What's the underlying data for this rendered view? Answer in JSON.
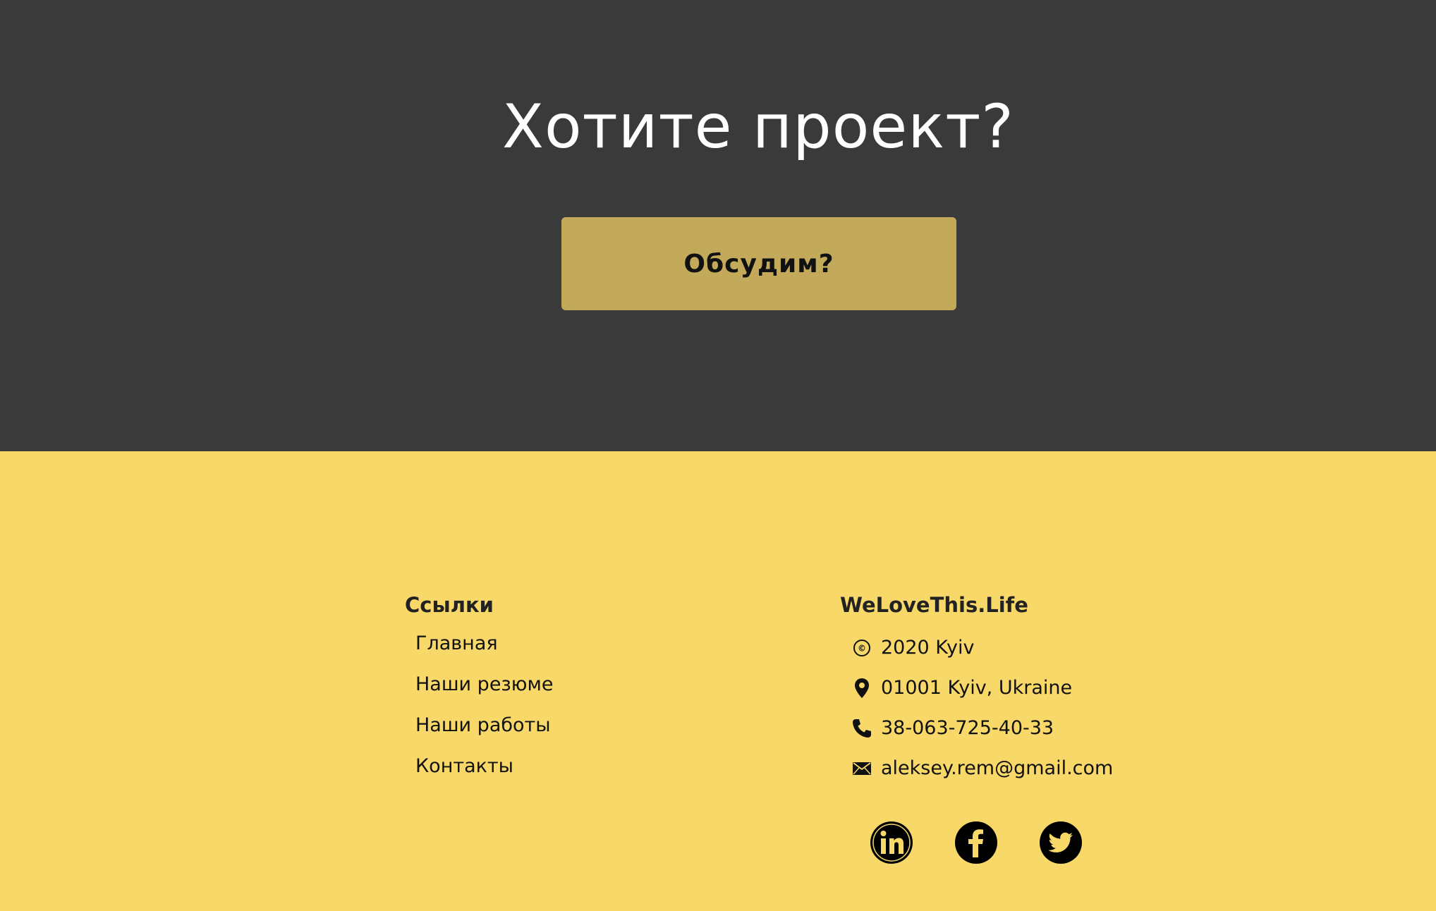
{
  "hero": {
    "title": "Хотите проект?",
    "cta_label": "Обсудим?"
  },
  "footer": {
    "links_title": "Ссылки",
    "links": [
      {
        "label": "Главная"
      },
      {
        "label": "Наши резюме"
      },
      {
        "label": "Наши работы"
      },
      {
        "label": "Контакты"
      }
    ],
    "brand_title": "WeLoveThis.Life",
    "contacts": [
      {
        "icon": "copyright-icon",
        "text": "2020 Kyiv"
      },
      {
        "icon": "location-pin-icon",
        "text": "01001 Kyiv, Ukraine"
      },
      {
        "icon": "phone-icon",
        "text": "38-063-725-40-33"
      },
      {
        "icon": "envelope-icon",
        "text": "aleksey.rem@gmail.com"
      }
    ],
    "social": [
      {
        "icon": "linkedin-icon"
      },
      {
        "icon": "facebook-icon"
      },
      {
        "icon": "twitter-icon"
      }
    ]
  },
  "colors": {
    "hero_bg": "#3a3a3a",
    "cta_bg": "#c3aa5a",
    "footer_bg": "#f8d869"
  }
}
